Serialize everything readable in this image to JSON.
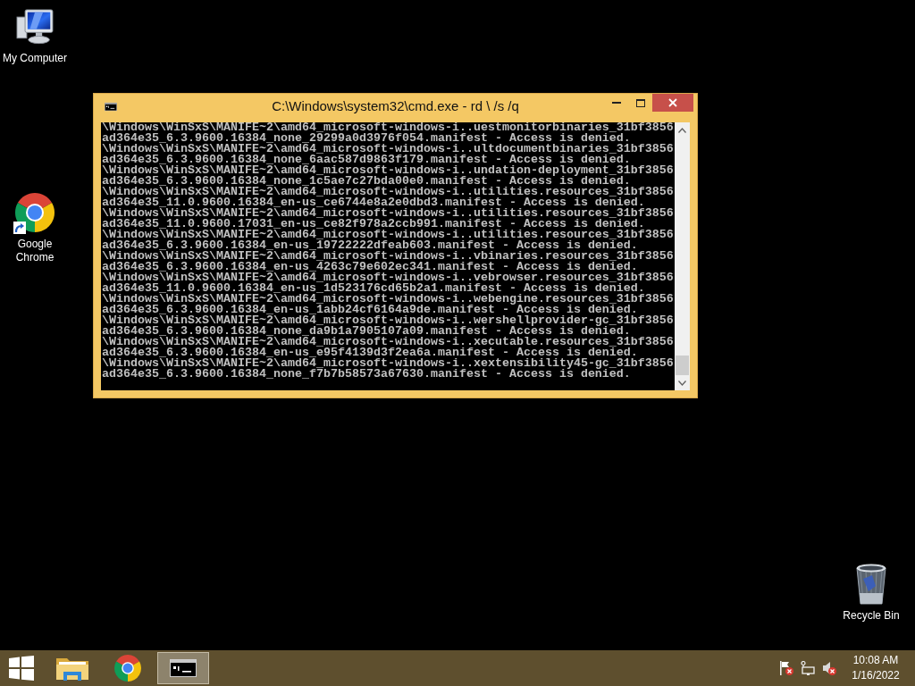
{
  "desktop": {
    "icons": [
      {
        "kind": "computer",
        "label": "My Computer",
        "shortcut": false
      },
      {
        "kind": "browser",
        "label": "Google Chrome",
        "shortcut": true
      }
    ],
    "recycle_bin": {
      "label": "Recycle Bin"
    }
  },
  "window": {
    "title": "C:\\Windows\\system32\\cmd.exe - rd \\ /s /q",
    "lines": [
      "\\Windows\\WinSxS\\MANIFE~2\\amd64_microsoft-windows-i..uestmonitorbinaries_31bf3856",
      "ad364e35_6.3.9600.16384_none_29299a0d3976f054.manifest - Access is denied.",
      "\\Windows\\WinSxS\\MANIFE~2\\amd64_microsoft-windows-i..ultdocumentbinaries_31bf3856",
      "ad364e35_6.3.9600.16384_none_6aac587d9863f179.manifest - Access is denied.",
      "\\Windows\\WinSxS\\MANIFE~2\\amd64_microsoft-windows-i..undation-deployment_31bf3856",
      "ad364e35_6.3.9600.16384_none_1c5ae7c27bda00e0.manifest - Access is denied.",
      "\\Windows\\WinSxS\\MANIFE~2\\amd64_microsoft-windows-i..utilities.resources_31bf3856",
      "ad364e35_11.0.9600.16384_en-us_ce6744e8a2e0dbd3.manifest - Access is denied.",
      "\\Windows\\WinSxS\\MANIFE~2\\amd64_microsoft-windows-i..utilities.resources_31bf3856",
      "ad364e35_11.0.9600.17031_en-us_ce82f978a2ccb991.manifest - Access is denied.",
      "\\Windows\\WinSxS\\MANIFE~2\\amd64_microsoft-windows-i..utilities.resources_31bf3856",
      "ad364e35_6.3.9600.16384_en-us_19722222dfeab603.manifest - Access is denied.",
      "\\Windows\\WinSxS\\MANIFE~2\\amd64_microsoft-windows-i..vbinaries.resources_31bf3856",
      "ad364e35_6.3.9600.16384_en-us_4263c79e602ec341.manifest - Access is denied.",
      "\\Windows\\WinSxS\\MANIFE~2\\amd64_microsoft-windows-i..vebrowser.resources_31bf3856",
      "ad364e35_11.0.9600.16384_en-us_1d523176cd65b2a1.manifest - Access is denied.",
      "\\Windows\\WinSxS\\MANIFE~2\\amd64_microsoft-windows-i..webengine.resources_31bf3856",
      "ad364e35_6.3.9600.16384_en-us_1abb24cf6164a9de.manifest - Access is denied.",
      "\\Windows\\WinSxS\\MANIFE~2\\amd64_microsoft-windows-i..wershellprovider-gc_31bf3856",
      "ad364e35_6.3.9600.16384_none_da9b1a7905107a09.manifest - Access is denied.",
      "\\Windows\\WinSxS\\MANIFE~2\\amd64_microsoft-windows-i..xecutable.resources_31bf3856",
      "ad364e35_6.3.9600.16384_en-us_e95f4139d3f2ea6a.manifest - Access is denied.",
      "\\Windows\\WinSxS\\MANIFE~2\\amd64_microsoft-windows-i..xextensibility45-gc_31bf3856",
      "ad364e35_6.3.9600.16384_none_f7b7b58573a67630.manifest - Access is denied."
    ]
  },
  "taskbar": {
    "items": [
      {
        "kind": "folder",
        "selected": false
      },
      {
        "kind": "browser",
        "selected": false
      },
      {
        "kind": "console",
        "selected": true
      }
    ],
    "clock": {
      "time": "10:08 AM",
      "date": "1/16/2022"
    }
  }
}
